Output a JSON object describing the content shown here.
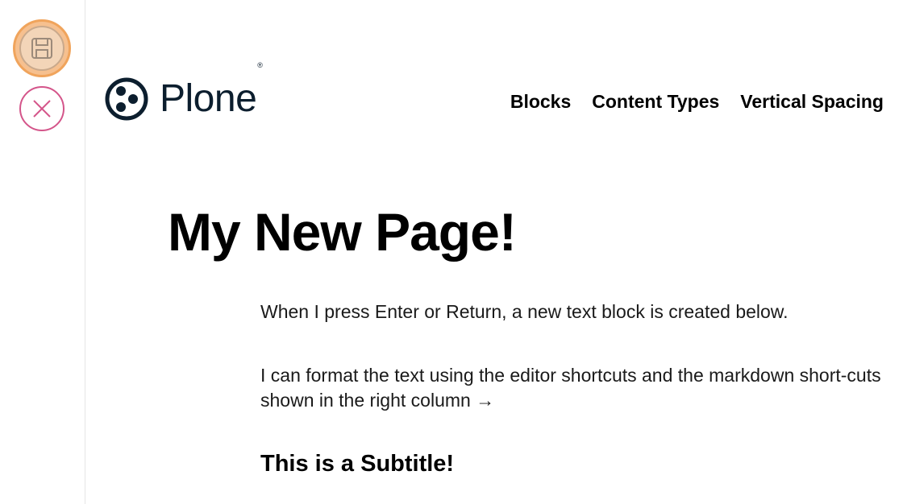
{
  "toolbar": {
    "save_icon": "floppy-disk-icon",
    "close_icon": "close-icon",
    "save_color": "#f6c08f",
    "close_color": "#d4558a"
  },
  "header": {
    "logo_text": "Plone",
    "logo_registered": "®",
    "nav": [
      "Blocks",
      "Content Types",
      "Vertical Spacing"
    ]
  },
  "main": {
    "title": "My New Page!",
    "paragraphs": [
      "When I press Enter or Return, a new text block is created below.",
      "I can format the text using the editor shortcuts and the markdown short-cuts shown in the right column →"
    ],
    "subtitle": "This is a Subtitle!"
  }
}
